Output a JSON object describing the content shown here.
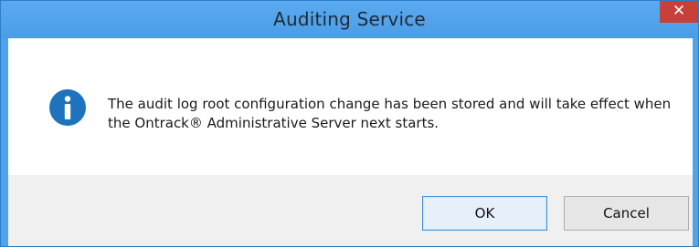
{
  "window": {
    "title": "Auditing Service",
    "close_glyph": "✕"
  },
  "message": {
    "icon": "info-icon",
    "text": "The audit log root configuration change has been stored and will take effect when the Ontrack® Administrative Server next starts."
  },
  "buttons": {
    "ok_label": "OK",
    "cancel_label": "Cancel"
  },
  "colors": {
    "titlebar": "#4fa3e8",
    "close": "#c7413a",
    "info_icon": "#1e73be"
  }
}
